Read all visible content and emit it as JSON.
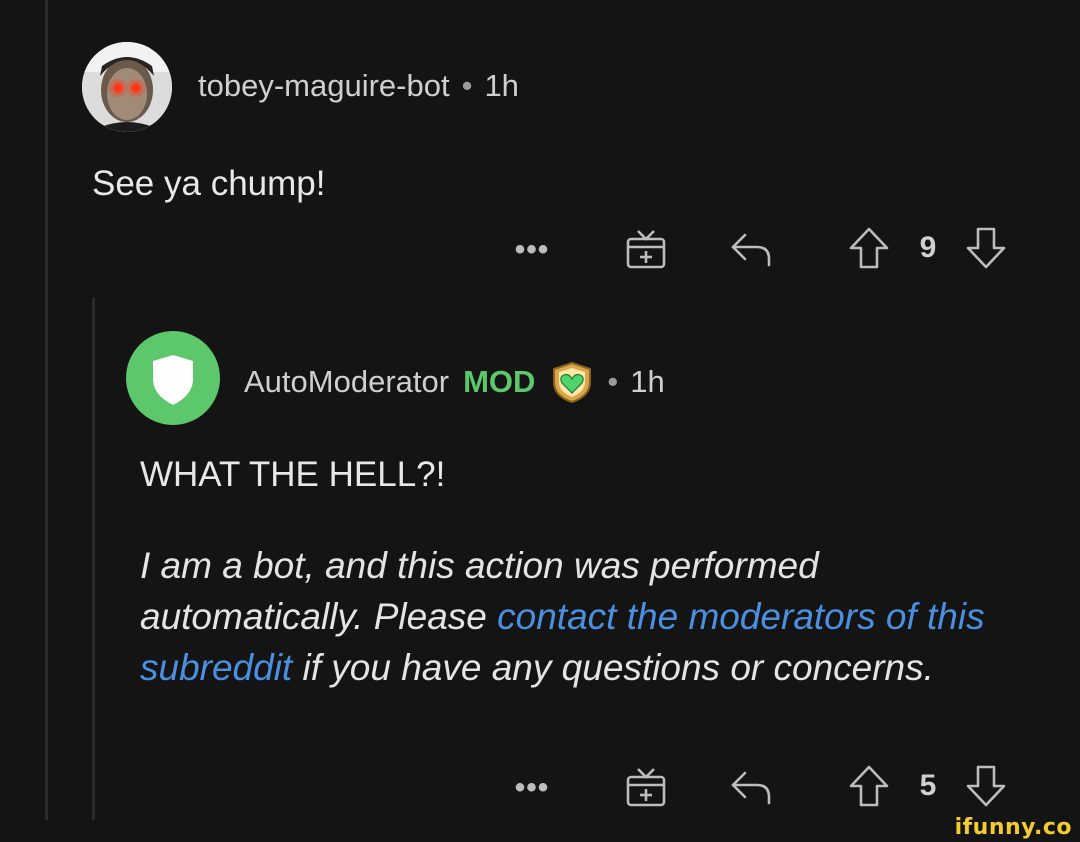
{
  "comment1": {
    "username": "tobey-maguire-bot",
    "separator": "•",
    "time": "1h",
    "body": "See ya chump!",
    "more_label": "•••",
    "votes": "9",
    "icons": {
      "more": "more-dots-icon",
      "award": "gift-icon",
      "reply": "reply-arrow-icon",
      "upvote": "upvote-arrow-icon",
      "downvote": "downvote-arrow-icon"
    }
  },
  "comment2": {
    "username": "AutoModerator",
    "mod_badge": "MOD",
    "separator": "•",
    "time": "1h",
    "body": "WHAT THE HELL?!",
    "note_part1": "I am a bot, and this action was performed automatically. Please ",
    "note_link": "contact the moderators of this subreddit",
    "note_part2": " if you have any questions or concerns.",
    "more_label": "•••",
    "votes": "5",
    "icons": {
      "avatar": "shield-icon",
      "flair": "heart-shield-icon"
    }
  },
  "watermark": "ifunny.co",
  "colors": {
    "background": "#141414",
    "mod_green": "#5cc76b",
    "link_blue": "#4b8fe0",
    "avatar_green": "#5cc76b",
    "watermark_yellow": "#f3cc2f"
  }
}
